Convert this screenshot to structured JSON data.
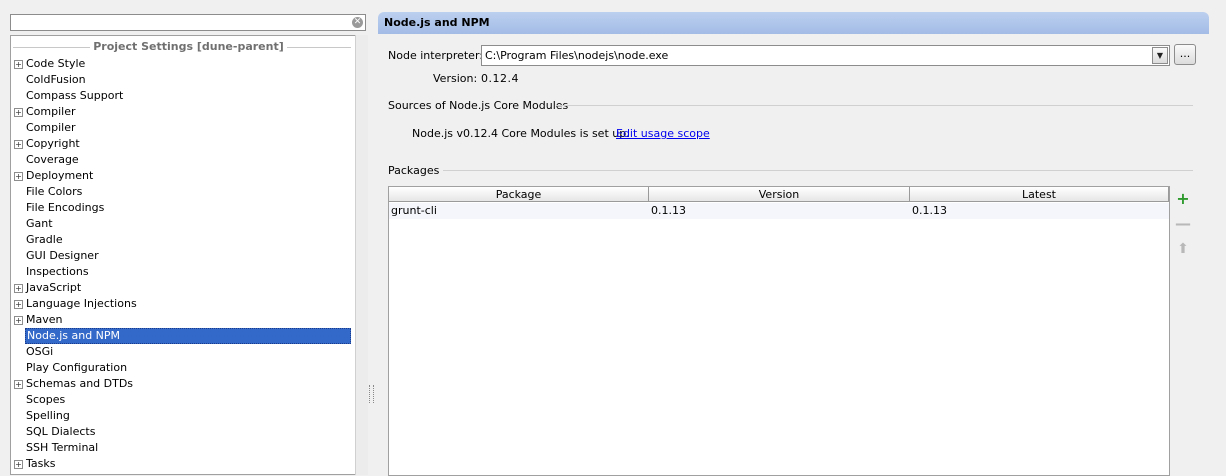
{
  "search": {
    "value": "",
    "clear_icon": "clear-icon"
  },
  "tree": {
    "header": "Project Settings [dune-parent]",
    "items": [
      {
        "label": "Code Style",
        "expandable": true
      },
      {
        "label": "ColdFusion",
        "expandable": false
      },
      {
        "label": "Compass Support",
        "expandable": false
      },
      {
        "label": "Compiler",
        "expandable": true
      },
      {
        "label": "Compiler",
        "expandable": false
      },
      {
        "label": "Copyright",
        "expandable": true
      },
      {
        "label": "Coverage",
        "expandable": false
      },
      {
        "label": "Deployment",
        "expandable": true
      },
      {
        "label": "File Colors",
        "expandable": false
      },
      {
        "label": "File Encodings",
        "expandable": false
      },
      {
        "label": "Gant",
        "expandable": false
      },
      {
        "label": "Gradle",
        "expandable": false
      },
      {
        "label": "GUI Designer",
        "expandable": false
      },
      {
        "label": "Inspections",
        "expandable": false
      },
      {
        "label": "JavaScript",
        "expandable": true
      },
      {
        "label": "Language Injections",
        "expandable": true
      },
      {
        "label": "Maven",
        "expandable": true
      },
      {
        "label": "Node.js and NPM",
        "expandable": false,
        "selected": true
      },
      {
        "label": "OSGi",
        "expandable": false
      },
      {
        "label": "Play Configuration",
        "expandable": false
      },
      {
        "label": "Schemas and DTDs",
        "expandable": true
      },
      {
        "label": "Scopes",
        "expandable": false
      },
      {
        "label": "Spelling",
        "expandable": false
      },
      {
        "label": "SQL Dialects",
        "expandable": false
      },
      {
        "label": "SSH Terminal",
        "expandable": false
      },
      {
        "label": "Tasks",
        "expandable": true
      }
    ]
  },
  "content": {
    "title": "Node.js and NPM",
    "interpreter_label": "Node interpreter:",
    "interpreter_value": "C:\\Program Files\\nodejs\\node.exe",
    "browse_label": "...",
    "version_label": "Version:",
    "version_value": "0.12.4",
    "core_modules_title": "Sources of Node.js Core Modules",
    "core_modules_status": "Node.js v0.12.4 Core Modules is set up.",
    "edit_scope_link": "Edit usage scope",
    "packages_title": "Packages",
    "table": {
      "columns": [
        "Package",
        "Version",
        "Latest"
      ],
      "rows": [
        {
          "package": "grunt-cli",
          "version": "0.1.13",
          "latest": "0.1.13"
        }
      ]
    },
    "actions": {
      "add_icon": "plus-icon",
      "remove_icon": "minus-icon",
      "upgrade_icon": "arrow-up-icon"
    },
    "colors": {
      "add": "#2e9a2e",
      "disabled": "#b8b8b8",
      "selection": "#3369c9",
      "link": "#0000ee"
    }
  }
}
